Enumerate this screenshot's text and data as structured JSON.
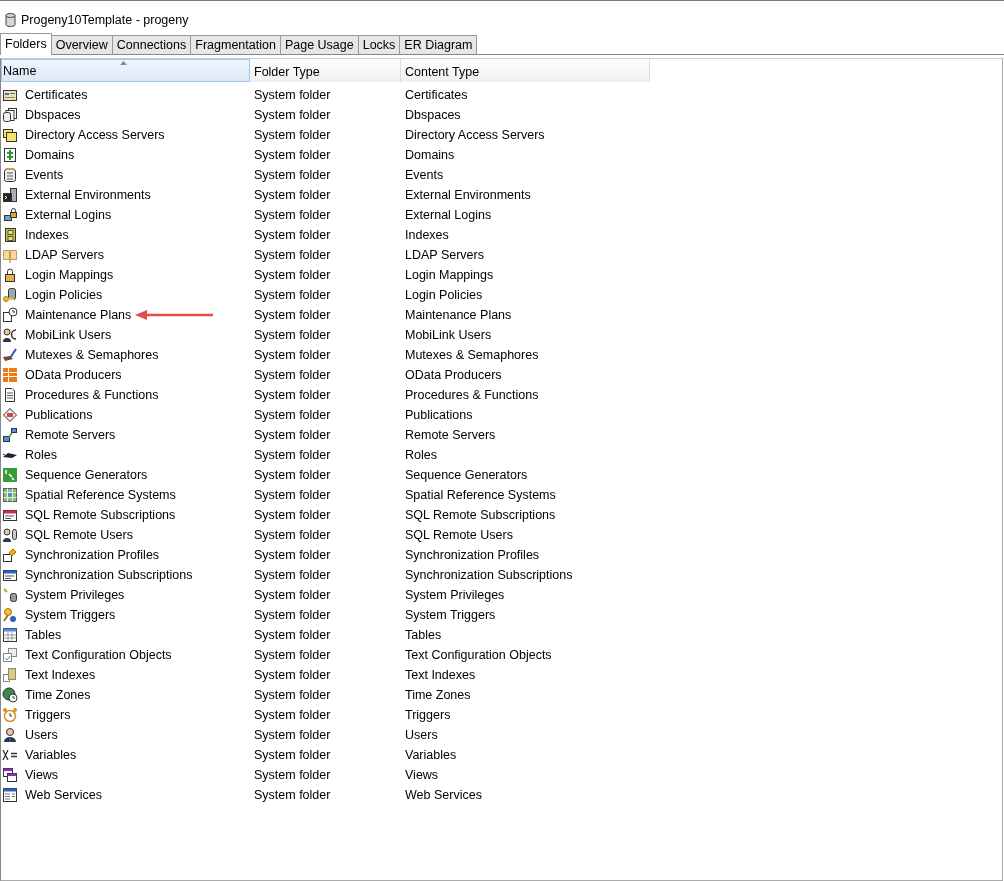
{
  "window": {
    "title": "Progeny10Template - progeny"
  },
  "tabs": [
    {
      "label": "Folders",
      "selected": true
    },
    {
      "label": "Overview",
      "selected": false
    },
    {
      "label": "Connections",
      "selected": false
    },
    {
      "label": "Fragmentation",
      "selected": false
    },
    {
      "label": "Page Usage",
      "selected": false
    },
    {
      "label": "Locks",
      "selected": false
    },
    {
      "label": "ER Diagram",
      "selected": false
    }
  ],
  "table": {
    "columns": [
      {
        "label": "Name",
        "sorted": true
      },
      {
        "label": "Folder Type",
        "sorted": false
      },
      {
        "label": "Content Type",
        "sorted": false
      }
    ],
    "rows": [
      {
        "name": "Certificates",
        "folder_type": "System folder",
        "content_type": "Certificates",
        "pointed": false
      },
      {
        "name": "Dbspaces",
        "folder_type": "System folder",
        "content_type": "Dbspaces",
        "pointed": false
      },
      {
        "name": "Directory Access Servers",
        "folder_type": "System folder",
        "content_type": "Directory Access Servers",
        "pointed": false
      },
      {
        "name": "Domains",
        "folder_type": "System folder",
        "content_type": "Domains",
        "pointed": false
      },
      {
        "name": "Events",
        "folder_type": "System folder",
        "content_type": "Events",
        "pointed": false
      },
      {
        "name": "External Environments",
        "folder_type": "System folder",
        "content_type": "External Environments",
        "pointed": false
      },
      {
        "name": "External Logins",
        "folder_type": "System folder",
        "content_type": "External Logins",
        "pointed": false
      },
      {
        "name": "Indexes",
        "folder_type": "System folder",
        "content_type": "Indexes",
        "pointed": false
      },
      {
        "name": "LDAP Servers",
        "folder_type": "System folder",
        "content_type": "LDAP Servers",
        "pointed": false
      },
      {
        "name": "Login Mappings",
        "folder_type": "System folder",
        "content_type": "Login Mappings",
        "pointed": false
      },
      {
        "name": "Login Policies",
        "folder_type": "System folder",
        "content_type": "Login Policies",
        "pointed": false
      },
      {
        "name": "Maintenance Plans",
        "folder_type": "System folder",
        "content_type": "Maintenance Plans",
        "pointed": true
      },
      {
        "name": "MobiLink Users",
        "folder_type": "System folder",
        "content_type": "MobiLink Users",
        "pointed": false
      },
      {
        "name": "Mutexes & Semaphores",
        "folder_type": "System folder",
        "content_type": "Mutexes & Semaphores",
        "pointed": false
      },
      {
        "name": "OData Producers",
        "folder_type": "System folder",
        "content_type": "OData Producers",
        "pointed": false
      },
      {
        "name": "Procedures & Functions",
        "folder_type": "System folder",
        "content_type": "Procedures & Functions",
        "pointed": false
      },
      {
        "name": "Publications",
        "folder_type": "System folder",
        "content_type": "Publications",
        "pointed": false
      },
      {
        "name": "Remote Servers",
        "folder_type": "System folder",
        "content_type": "Remote Servers",
        "pointed": false
      },
      {
        "name": "Roles",
        "folder_type": "System folder",
        "content_type": "Roles",
        "pointed": false
      },
      {
        "name": "Sequence Generators",
        "folder_type": "System folder",
        "content_type": "Sequence Generators",
        "pointed": false
      },
      {
        "name": "Spatial Reference Systems",
        "folder_type": "System folder",
        "content_type": "Spatial Reference Systems",
        "pointed": false
      },
      {
        "name": "SQL Remote Subscriptions",
        "folder_type": "System folder",
        "content_type": "SQL Remote Subscriptions",
        "pointed": false
      },
      {
        "name": "SQL Remote Users",
        "folder_type": "System folder",
        "content_type": "SQL Remote Users",
        "pointed": false
      },
      {
        "name": "Synchronization Profiles",
        "folder_type": "System folder",
        "content_type": "Synchronization Profiles",
        "pointed": false
      },
      {
        "name": "Synchronization Subscriptions",
        "folder_type": "System folder",
        "content_type": "Synchronization Subscriptions",
        "pointed": false
      },
      {
        "name": "System Privileges",
        "folder_type": "System folder",
        "content_type": "System Privileges",
        "pointed": false
      },
      {
        "name": "System Triggers",
        "folder_type": "System folder",
        "content_type": "System Triggers",
        "pointed": false
      },
      {
        "name": "Tables",
        "folder_type": "System folder",
        "content_type": "Tables",
        "pointed": false
      },
      {
        "name": "Text Configuration Objects",
        "folder_type": "System folder",
        "content_type": "Text Configuration Objects",
        "pointed": false
      },
      {
        "name": "Text Indexes",
        "folder_type": "System folder",
        "content_type": "Text Indexes",
        "pointed": false
      },
      {
        "name": "Time Zones",
        "folder_type": "System folder",
        "content_type": "Time Zones",
        "pointed": false
      },
      {
        "name": "Triggers",
        "folder_type": "System folder",
        "content_type": "Triggers",
        "pointed": false
      },
      {
        "name": "Users",
        "folder_type": "System folder",
        "content_type": "Users",
        "pointed": false
      },
      {
        "name": "Variables",
        "folder_type": "System folder",
        "content_type": "Variables",
        "pointed": false
      },
      {
        "name": "Views",
        "folder_type": "System folder",
        "content_type": "Views",
        "pointed": false
      },
      {
        "name": "Web Services",
        "folder_type": "System folder",
        "content_type": "Web Services",
        "pointed": false
      }
    ]
  }
}
